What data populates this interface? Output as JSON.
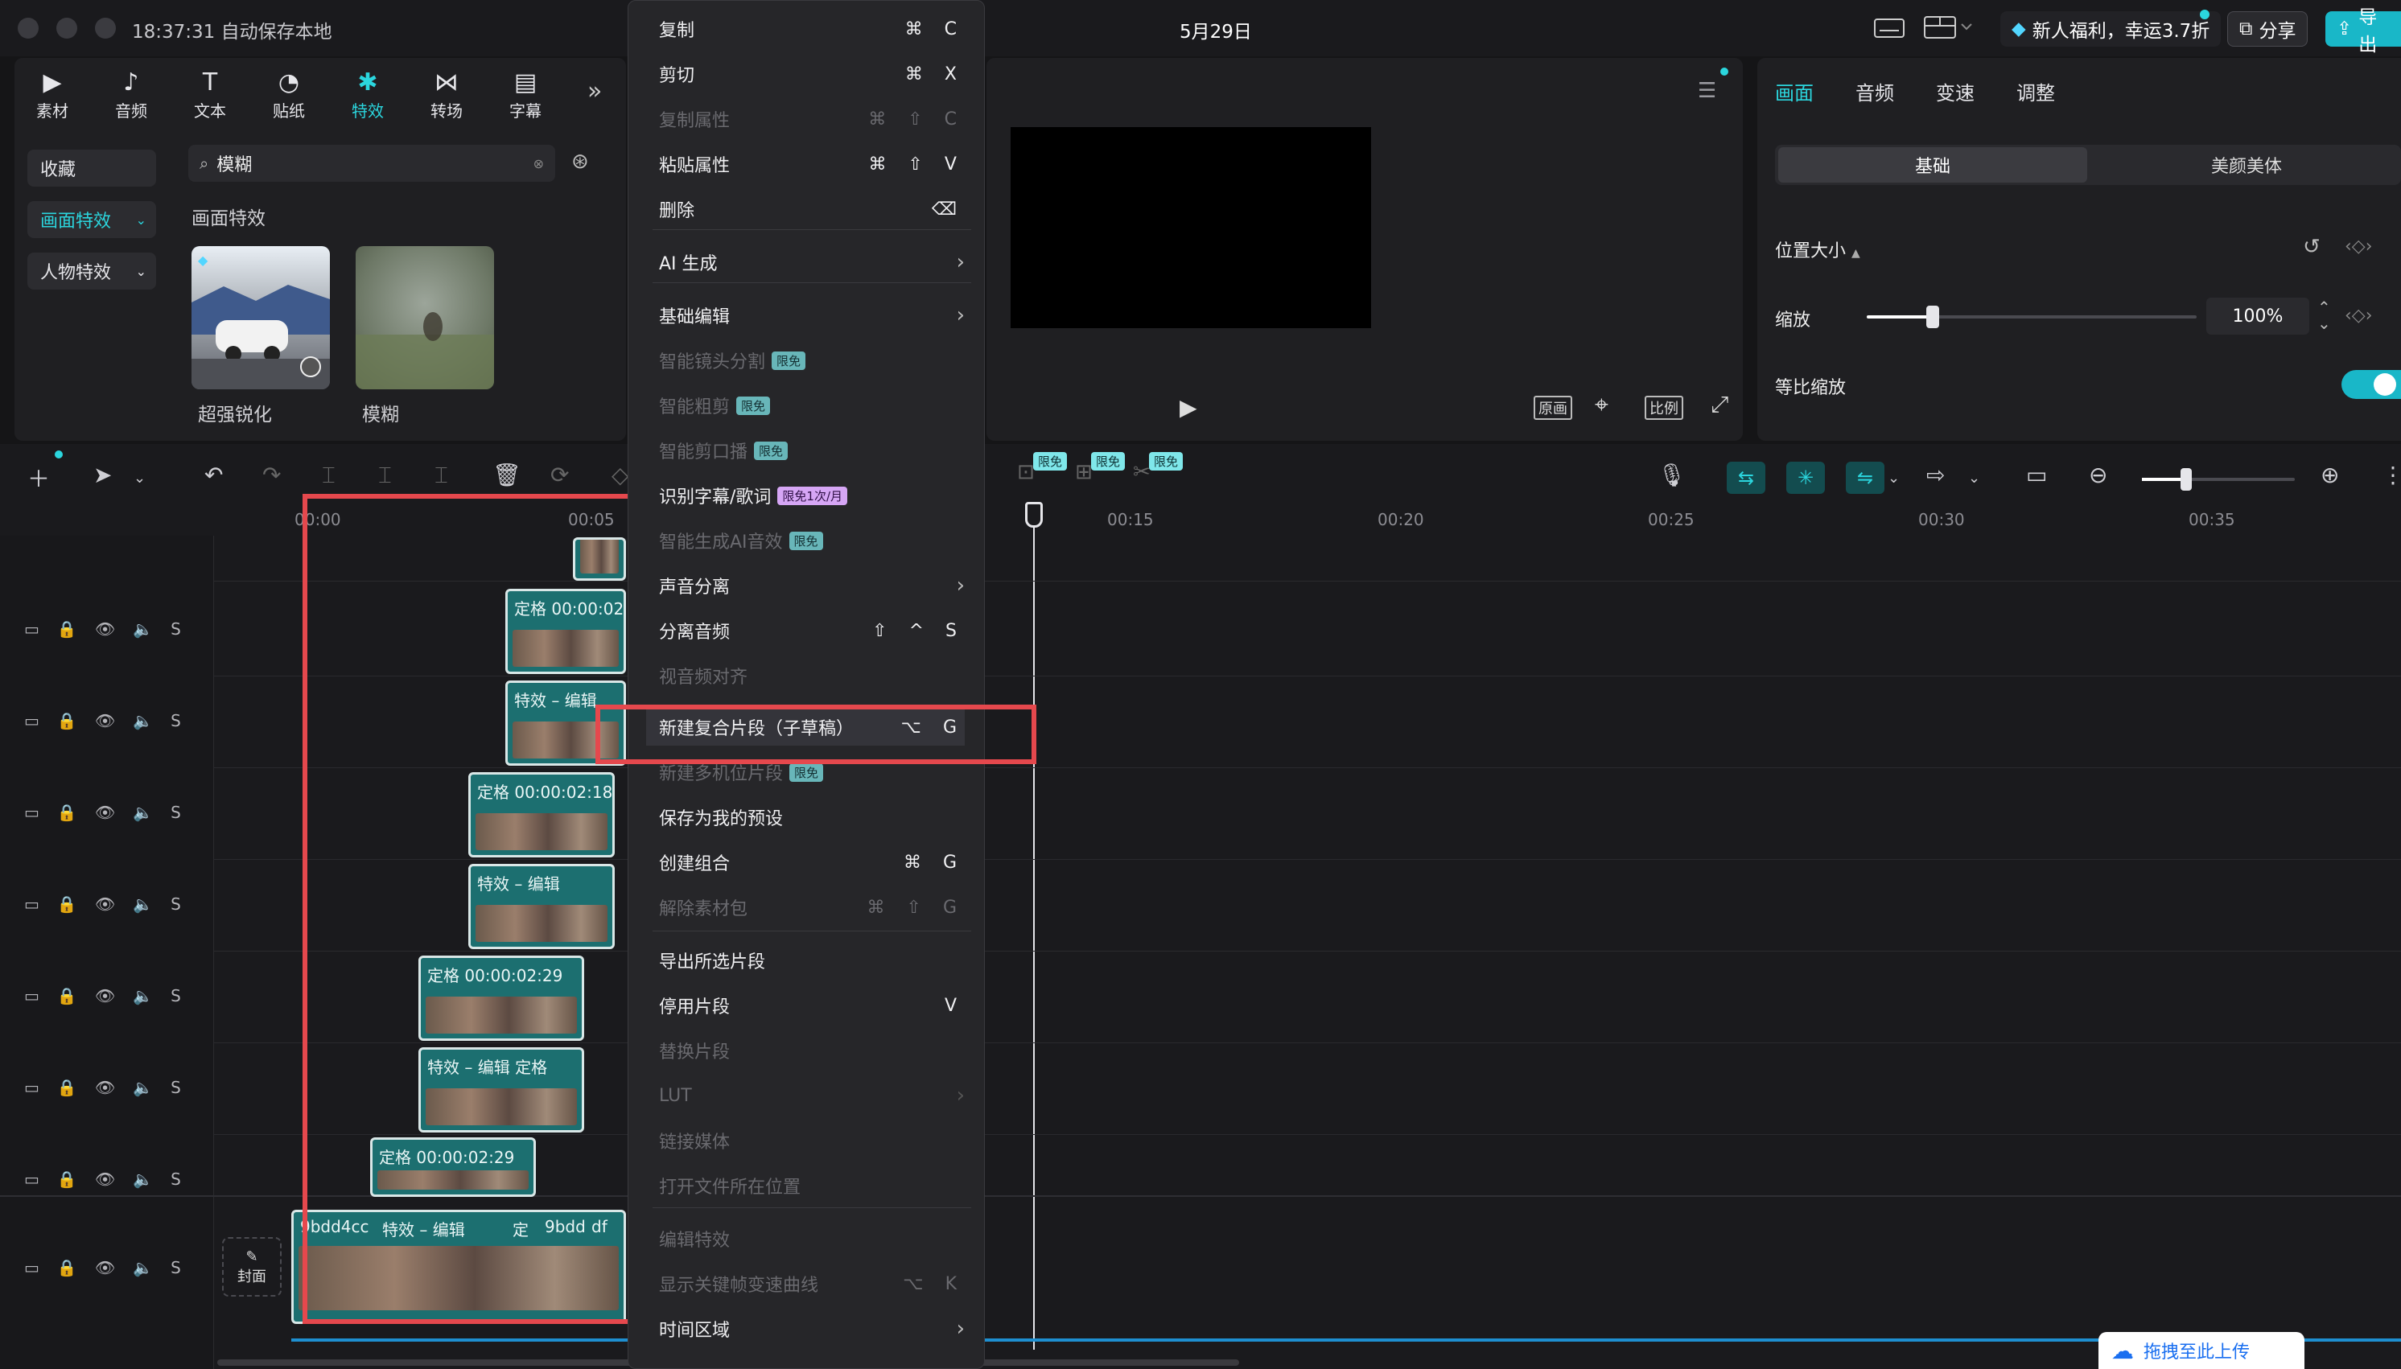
{
  "titlebar": {
    "time_status": "18:37:31 自动保存本地",
    "date": "5月29日",
    "promo": "新人福利，幸运3.7折",
    "share": "分享",
    "export": "导出"
  },
  "toolbar_tabs": [
    {
      "label": "素材",
      "icon": "media-icon"
    },
    {
      "label": "音频",
      "icon": "audio-icon"
    },
    {
      "label": "文本",
      "icon": "text-icon"
    },
    {
      "label": "贴纸",
      "icon": "sticker-icon"
    },
    {
      "label": "特效",
      "icon": "effects-icon"
    },
    {
      "label": "转场",
      "icon": "transition-icon"
    },
    {
      "label": "字幕",
      "icon": "subtitle-icon"
    }
  ],
  "sidebar": {
    "favorites": "收藏",
    "screen_effects": "画面特效",
    "people_effects": "人物特效"
  },
  "search": {
    "value": "模糊"
  },
  "effects_section": "画面特效",
  "effect_items": [
    {
      "label": "超强锐化"
    },
    {
      "label": "模糊"
    }
  ],
  "preview": {
    "btn_original": "原画",
    "btn_ratio": "比例"
  },
  "right_panel": {
    "tabs": [
      "画面",
      "音频",
      "变速",
      "调整"
    ],
    "seg_basic": "基础",
    "seg_beauty": "美颜美体",
    "section_title": "位置大小",
    "scale_label": "缩放",
    "scale_value": "100%",
    "scale_fraction": 0.2,
    "ratio_label": "等比缩放"
  },
  "context_menu": [
    {
      "label": "复制",
      "shortcut": "⌘ C",
      "disabled": false
    },
    {
      "label": "剪切",
      "shortcut": "⌘ X",
      "disabled": false
    },
    {
      "label": "复制属性",
      "shortcut": "⌘ ⇧ C",
      "disabled": true
    },
    {
      "label": "粘贴属性",
      "shortcut": "⌘ ⇧ V",
      "disabled": false
    },
    {
      "label": "删除",
      "shortcut": "⌫",
      "disabled": false
    },
    {
      "label": "AI 生成",
      "submenu": true,
      "disabled": false
    },
    {
      "label": "基础编辑",
      "submenu": true,
      "disabled": false
    },
    {
      "label": "智能镜头分割",
      "badge": "限免",
      "disabled": true
    },
    {
      "label": "智能粗剪",
      "badge": "限免",
      "disabled": true
    },
    {
      "label": "智能剪口播",
      "badge": "限免",
      "disabled": true
    },
    {
      "label": "识别字幕/歌词",
      "badge": "限免1次/月",
      "badge_style": "pink",
      "disabled": false
    },
    {
      "label": "智能生成AI音效",
      "badge": "限免",
      "disabled": true
    },
    {
      "label": "声音分离",
      "submenu": true,
      "disabled": false
    },
    {
      "label": "分离音频",
      "shortcut": "⇧ ^ S",
      "disabled": false
    },
    {
      "label": "视音频对齐",
      "disabled": true
    },
    {
      "label": "新建复合片段（子草稿）",
      "shortcut": "⌥ G",
      "disabled": false,
      "highlighted": true
    },
    {
      "label": "新建多机位片段",
      "badge": "限免",
      "disabled": true
    },
    {
      "label": "保存为我的预设",
      "disabled": false
    },
    {
      "label": "创建组合",
      "shortcut": "⌘ G",
      "disabled": false
    },
    {
      "label": "解除素材包",
      "shortcut": "⌘ ⇧ G",
      "disabled": true
    },
    {
      "label": "导出所选片段",
      "disabled": false
    },
    {
      "label": "停用片段",
      "shortcut": "V",
      "disabled": false
    },
    {
      "label": "替换片段",
      "disabled": true
    },
    {
      "label": "LUT",
      "submenu": true,
      "disabled": true
    },
    {
      "label": "链接媒体",
      "disabled": true
    },
    {
      "label": "打开文件所在位置",
      "disabled": true
    },
    {
      "label": "编辑特效",
      "disabled": true
    },
    {
      "label": "显示关键帧变速曲线",
      "shortcut": "⌥ K",
      "disabled": true
    },
    {
      "label": "时间区域",
      "submenu": true,
      "disabled": false
    }
  ],
  "timeline": {
    "ruler": [
      "00:00",
      "00:05",
      "00:15",
      "00:20",
      "00:25",
      "00:30",
      "00:35"
    ],
    "badges": [
      "限免",
      "限免",
      "限免"
    ],
    "cover": "封面",
    "upload": "拖拽至此上传",
    "track_solo": "S",
    "clips": [
      {
        "label": "定格 00:00:02"
      },
      {
        "label": "特效 – 编辑"
      },
      {
        "label": "定格 00:00:02:18"
      },
      {
        "label": "特效 – 编辑"
      },
      {
        "label": "定格 00:00:02:29"
      },
      {
        "label": "特效 – 编辑 定格"
      },
      {
        "label": "定格 00:00:02:29"
      }
    ],
    "main_clip": {
      "label": "9bdd4cc",
      "mid": "特效 – 编辑",
      "tail1": "定",
      "tail2": "9bdd",
      "tail3": "df"
    }
  }
}
